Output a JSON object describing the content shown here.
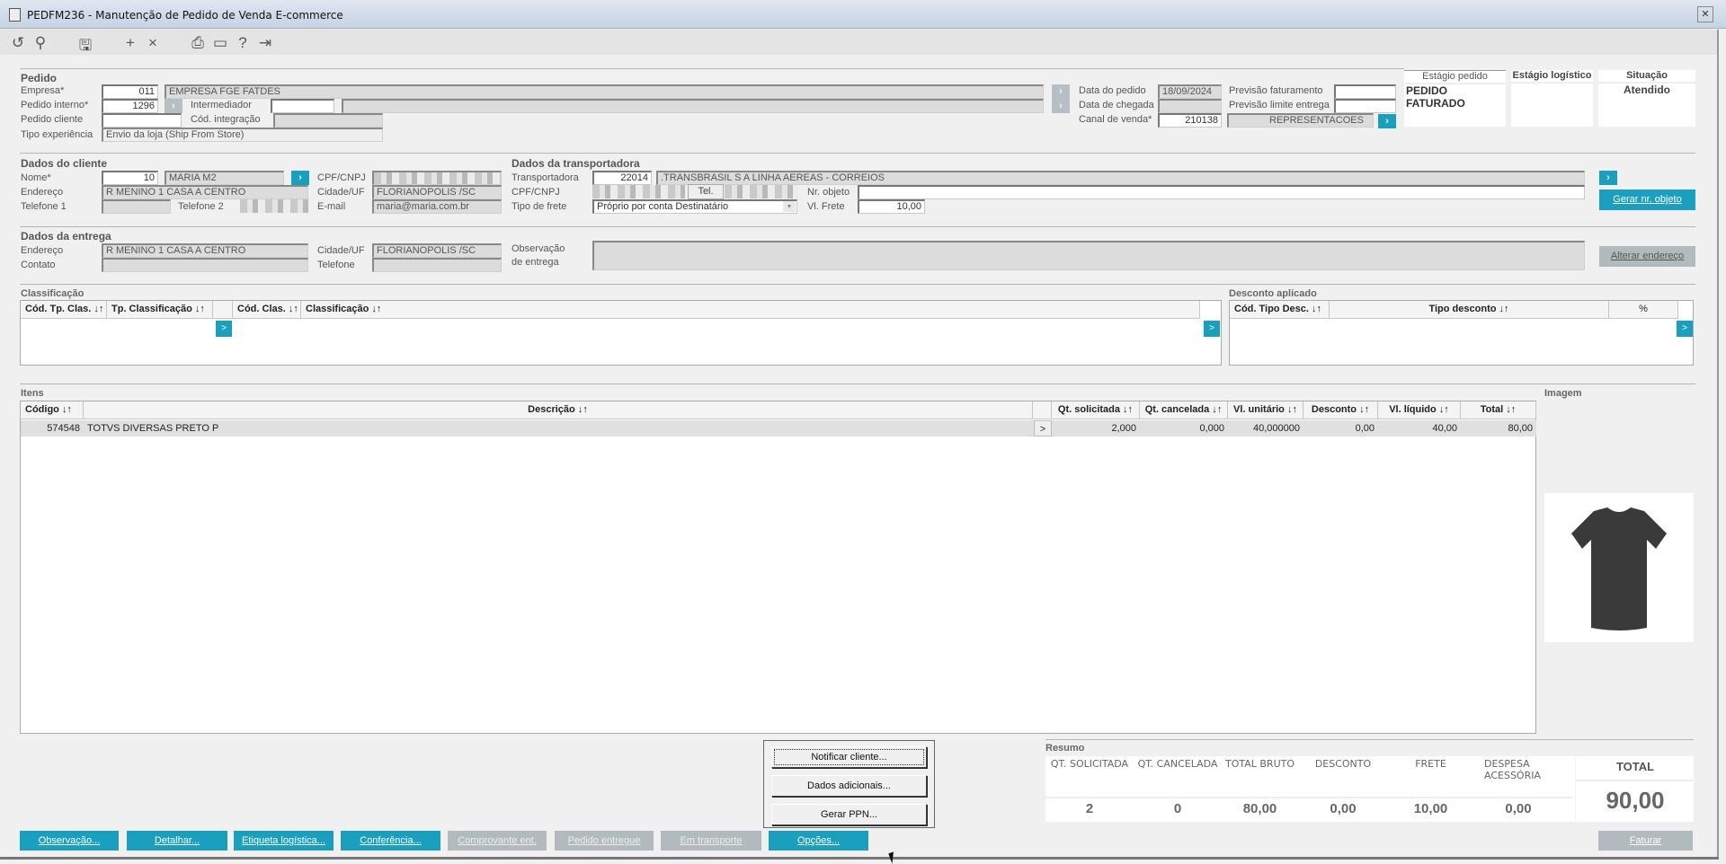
{
  "window": {
    "title": "PEDFM236 - Manutenção de Pedido de Venda E-commerce",
    "close": "✕"
  },
  "toolbar": [
    "undo-icon",
    "search-icon",
    "save-icon",
    "add-icon",
    "delete-icon",
    "print-icon",
    "calendar-icon",
    "help-icon",
    "exit-icon"
  ],
  "pedido": {
    "section": "Pedido",
    "empresa_label": "Empresa*",
    "empresa_code": "011",
    "empresa_name": "EMPRESA FGE FATDES",
    "pedido_interno_label": "Pedido interno*",
    "pedido_interno": "1296",
    "intermediador_label": "Intermediador",
    "pedido_cliente_label": "Pedido cliente",
    "cod_integracao_label": "Cód. integração",
    "tipo_experiencia_label": "Tipo experiência",
    "tipo_experiencia": "Envio da loja (Ship From Store)",
    "data_pedido_label": "Data do pedido",
    "data_pedido": "18/09/2024",
    "data_chegada_label": "Data de chegada",
    "canal_label": "Canal de venda*",
    "canal_code": "210138",
    "canal_name": "REPRESENTACOES",
    "prev_fat_label": "Previsão faturamento",
    "prev_entrega_label": "Previsão limite entrega"
  },
  "status": {
    "estagio_pedido_label": "Estágio pedido",
    "estagio_pedido": "PEDIDO FATURADO",
    "estagio_logistico_label": "Estágio logístico",
    "situacao_label": "Situação",
    "situacao": "Atendido"
  },
  "cliente": {
    "section": "Dados do cliente",
    "nome_label": "Nome*",
    "nome_code": "10",
    "nome": "MARIA M2",
    "cpf_label": "CPF/CNPJ",
    "endereco_label": "Endereço",
    "endereco": "R MENINO 1 CASA A CENTRO",
    "cidade_label": "Cidade/UF",
    "cidade": "FLORIANOPOLIS /SC",
    "tel1_label": "Telefone 1",
    "tel2_label": "Telefone 2",
    "email_label": "E-mail",
    "email": "maria@maria.com.br"
  },
  "transportadora": {
    "section": "Dados da transportadora",
    "label": "Transportadora",
    "code": "22014",
    "name": ".TRANSBRASIL S A LINHA AEREAS - CORREIOS",
    "cpf_label": "CPF/CNPJ",
    "tel_label": "Tel.",
    "nr_objeto_label": "Nr. objeto",
    "tipo_frete_label": "Tipo de frete",
    "tipo_frete": "Próprio por conta Destinatário",
    "vl_frete_label": "Vl. Frete",
    "vl_frete": "10,00",
    "gerar_nr_objeto": "Gerar nr. objeto"
  },
  "entrega": {
    "section": "Dados da entrega",
    "endereco_label": "Endereço",
    "endereco": "R MENINO 1 CASA A CENTRO",
    "cidade_label": "Cidade/UF",
    "cidade": "FLORIANOPOLIS /SC",
    "contato_label": "Contato",
    "telefone_label": "Telefone",
    "obs_label1": "Observação",
    "obs_label2": "de entrega",
    "alterar_endereco": "Alterar endereço"
  },
  "classificacao": {
    "section": "Classificação",
    "columns": [
      "Cód. Tp. Clas. ↓↑",
      "Tp. Classificação ↓↑",
      "Cód. Clas. ↓↑",
      "Classificação ↓↑"
    ]
  },
  "desconto": {
    "section": "Desconto aplicado",
    "columns": [
      "Cód. Tipo Desc. ↓↑",
      "Tipo desconto ↓↑",
      "%"
    ]
  },
  "itens": {
    "section": "Itens",
    "columns": [
      "Código ↓↑",
      "Descrição ↓↑",
      "Qt. solicitada ↓↑",
      "Qt. cancelada ↓↑",
      "Vl. unitário ↓↑",
      "Desconto ↓↑",
      "Vl. líquido ↓↑",
      "Total ↓↑"
    ],
    "rows": [
      {
        "codigo": "574548",
        "descricao": "TOTVS DIVERSAS PRETO P",
        "qt_sol": "2,000",
        "qt_canc": "0,000",
        "vl_unit": "40,000000",
        "desconto": "0,00",
        "vl_liq": "40,00",
        "total": "80,00"
      }
    ]
  },
  "imagem": {
    "label": "Imagem"
  },
  "resumo": {
    "section": "Resumo",
    "labels": [
      "QT. SOLICITADA",
      "QT. CANCELADA",
      "TOTAL BRUTO",
      "DESCONTO",
      "FRETE",
      "DESPESA ACESSÓRIA",
      "TOTAL"
    ],
    "values": [
      "2",
      "0",
      "80,00",
      "0,00",
      "10,00",
      "0,00",
      "90,00"
    ]
  },
  "popup": [
    "Notificar cliente...",
    "Dados adicionais...",
    "Gerar PPN..."
  ],
  "buttons": [
    "Observação...",
    "Detalhar...",
    "Etiqueta logística...",
    "Conferência...",
    "Comprovante ent.",
    "Pedido entregue",
    "Em transporte",
    "Opções..."
  ],
  "faturar": "Faturar",
  "arrow": "›",
  "small_arrow": ">"
}
